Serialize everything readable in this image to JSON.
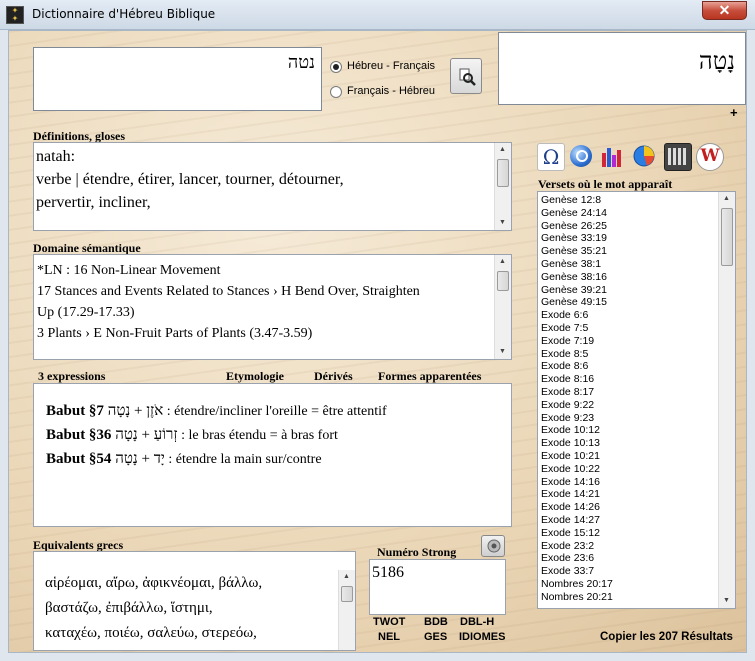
{
  "window": {
    "title": "Dictionnaire d'Hébreu Biblique"
  },
  "search": {
    "value": "נטה"
  },
  "direction": {
    "options": [
      "Hébreu - Français",
      "Français - Hébreu"
    ],
    "selected": "Hébreu - Français"
  },
  "word_display": {
    "hebrew": "נָטָה",
    "plus": "+"
  },
  "definitions": {
    "label": "Définitions, gloses",
    "lines": [
      "natah:",
      "verbe | étendre, étirer, lancer, tourner, détourner,",
      "pervertir, incliner,"
    ]
  },
  "semantic": {
    "label": "Domaine sémantique",
    "lines": [
      "*LN : 16 Non-Linear Movement",
      "17 Stances and Events Related to Stances › H Bend Over, Straighten",
      "Up (17.29-17.33)",
      "3 Plants › E Non-Fruit Parts of Plants (3.47-3.59)"
    ]
  },
  "expressions": {
    "count_label": "3 expressions",
    "links": [
      "Etymologie",
      "Dérivés",
      "Formes apparentées"
    ],
    "items": [
      {
        "ref": "Babut §7",
        "hebrew": "אֹזֶן + נָטָה",
        "text": " : étendre/incliner l'oreille = être attentif"
      },
      {
        "ref": "Babut §36",
        "hebrew": "זְרוֹעַ + נָטָה",
        "text": " : le bras étendu = à bras fort"
      },
      {
        "ref": "Babut §54",
        "hebrew": "יָד + נָטָה",
        "text": " : étendre la main sur/contre"
      }
    ]
  },
  "greek": {
    "label": "Equivalents grecs",
    "lines": [
      "αἱρέομαι, αἴρω, ἀφικνέομαι, βάλλω,",
      "βαστάζω, ἐπιβάλλω, ἵστημι,",
      "καταχέω, ποιέω, σαλεύω, στερεόω,"
    ]
  },
  "strong": {
    "label": "Numéro Strong",
    "value": "5186",
    "links_row1": [
      "TWOT",
      "BDB",
      "DBL-H"
    ],
    "links_row2": [
      "NEL",
      "GES",
      "IDIOMES"
    ]
  },
  "toolbar": {
    "icons": [
      "omega-icon",
      "search-globe-icon",
      "bar-chart-icon",
      "pie-chart-icon",
      "calculator-icon",
      "w-logo-icon"
    ]
  },
  "verses": {
    "label": "Versets où le mot apparaît",
    "items": [
      "Genèse 12:8",
      "Genèse 24:14",
      "Genèse 26:25",
      "Genèse 33:19",
      "Genèse 35:21",
      "Genèse 38:1",
      "Genèse 38:16",
      "Genèse 39:21",
      "Genèse 49:15",
      "Exode 6:6",
      "Exode 7:5",
      "Exode 7:19",
      "Exode 8:5",
      "Exode 8:6",
      "Exode 8:16",
      "Exode 8:17",
      "Exode 9:22",
      "Exode 9:23",
      "Exode 10:12",
      "Exode 10:13",
      "Exode 10:21",
      "Exode 10:22",
      "Exode 14:16",
      "Exode 14:21",
      "Exode 14:26",
      "Exode 14:27",
      "Exode 15:12",
      "Exode 23:2",
      "Exode 23:6",
      "Exode 33:7",
      "Nombres 20:17",
      "Nombres 20:21"
    ],
    "copy_label": "Copier les 207 Résultats"
  },
  "colors": {
    "accent_close": "#c74e3c",
    "parchment": "#ead6b6"
  }
}
